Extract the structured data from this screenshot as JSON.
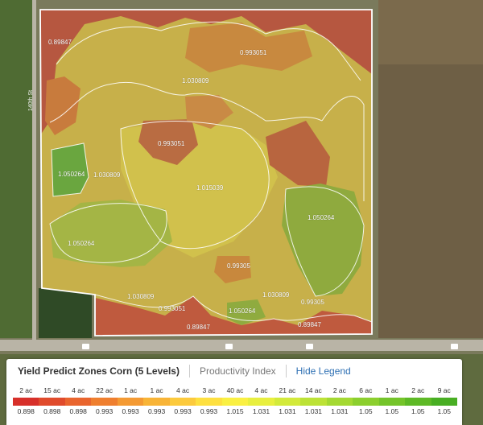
{
  "map": {
    "zone_labels": [
      "0.89847",
      "0.993051",
      "1.030809",
      "0.993051",
      "1.050264",
      "1.030809",
      "1.015039",
      "1.050264",
      "1.050264",
      "0.99305",
      "1.030809",
      "1.030809",
      "0.993051",
      "1.050264",
      "0.99305",
      "0.89847",
      "0.89847"
    ],
    "road_label": "140th St",
    "zone_colors": {
      "lowest": "#b54a3c",
      "low": "#c98b45",
      "mid": "#c9c244",
      "high": "#a9c24a",
      "highest": "#5ea636"
    }
  },
  "legend": {
    "title": "Yield Predict Zones Corn (5 Levels)",
    "tab": "Productivity Index",
    "hide_label": "Hide Legend",
    "bins": [
      {
        "acres": "2 ac",
        "value": "0.898",
        "color": "#d7302a"
      },
      {
        "acres": "15 ac",
        "value": "0.898",
        "color": "#e04b2c"
      },
      {
        "acres": "4 ac",
        "value": "0.898",
        "color": "#e9652e"
      },
      {
        "acres": "22 ac",
        "value": "0.993",
        "color": "#ef7f2f"
      },
      {
        "acres": "1 ac",
        "value": "0.993",
        "color": "#f49a33"
      },
      {
        "acres": "1 ac",
        "value": "0.993",
        "color": "#f8b437"
      },
      {
        "acres": "4 ac",
        "value": "0.993",
        "color": "#fcca3d"
      },
      {
        "acres": "3 ac",
        "value": "0.993",
        "color": "#fee040"
      },
      {
        "acres": "40 ac",
        "value": "1.015",
        "color": "#faf043"
      },
      {
        "acres": "4 ac",
        "value": "1.031",
        "color": "#e8ef3f"
      },
      {
        "acres": "21 ac",
        "value": "1.031",
        "color": "#d3ea3b"
      },
      {
        "acres": "14 ac",
        "value": "1.031",
        "color": "#bce236"
      },
      {
        "acres": "2 ac",
        "value": "1.031",
        "color": "#a4d932"
      },
      {
        "acres": "6 ac",
        "value": "1.05",
        "color": "#8ccf2e"
      },
      {
        "acres": "1 ac",
        "value": "1.05",
        "color": "#74c42a"
      },
      {
        "acres": "2 ac",
        "value": "1.05",
        "color": "#5eb926"
      },
      {
        "acres": "9 ac",
        "value": "1.05",
        "color": "#48ae23"
      }
    ]
  }
}
